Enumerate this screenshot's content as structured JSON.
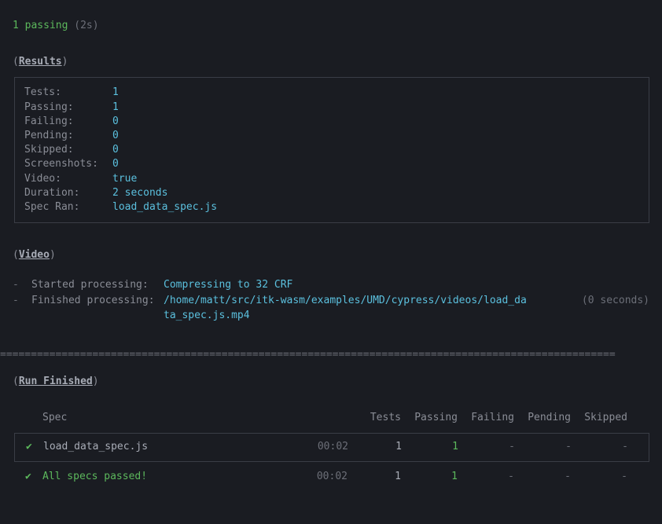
{
  "passing": {
    "count": "1 passing",
    "duration": "(2s)"
  },
  "results": {
    "title": "Results",
    "open_paren": "(",
    "close_paren": ")",
    "rows": {
      "tests": {
        "label": "Tests:",
        "value": "1"
      },
      "passing": {
        "label": "Passing:",
        "value": "1"
      },
      "failing": {
        "label": "Failing:",
        "value": "0"
      },
      "pending": {
        "label": "Pending:",
        "value": "0"
      },
      "skipped": {
        "label": "Skipped:",
        "value": "0"
      },
      "screenshots": {
        "label": "Screenshots:",
        "value": "0"
      },
      "video": {
        "label": "Video:",
        "value": "true"
      },
      "duration": {
        "label": "Duration:",
        "value": "2 seconds"
      },
      "spec_ran": {
        "label": "Spec Ran:",
        "value": "load_data_spec.js"
      }
    }
  },
  "video": {
    "title": "Video",
    "open_paren": "(",
    "close_paren": ")",
    "dash": "-",
    "started": {
      "label": "Started processing:",
      "value": "Compressing to 32 CRF"
    },
    "finished": {
      "label": "Finished processing:",
      "value_line1": "/home/matt/src/itk-wasm/examples/UMD/cypress/videos/load_da",
      "value_line2": "ta_spec.js.mp4",
      "time": "(0 seconds)"
    }
  },
  "divider": "====================================================================================================",
  "run_finished": {
    "title": "Run Finished",
    "open_paren": "(",
    "close_paren": ")"
  },
  "table": {
    "headers": {
      "spec": "Spec",
      "tests": "Tests",
      "passing": "Passing",
      "failing": "Failing",
      "pending": "Pending",
      "skipped": "Skipped"
    },
    "check": "✔",
    "row": {
      "spec": "load_data_spec.js",
      "time": "00:02",
      "tests": "1",
      "passing": "1",
      "failing": "-",
      "pending": "-",
      "skipped": "-"
    },
    "summary": {
      "spec": "All specs passed!",
      "time": "00:02",
      "tests": "1",
      "passing": "1",
      "failing": "-",
      "pending": "-",
      "skipped": "-"
    }
  }
}
